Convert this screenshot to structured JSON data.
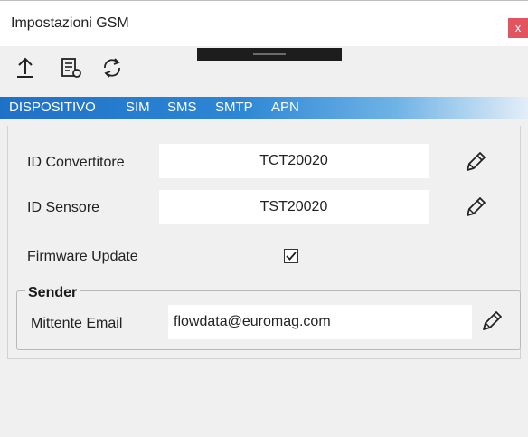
{
  "window": {
    "title": "Impostazioni GSM",
    "close_label": "x"
  },
  "toolbar": {
    "icons": [
      "upload-icon",
      "form-settings-icon",
      "refresh-icon"
    ]
  },
  "tabs": [
    {
      "label": "DISPOSITIVO"
    },
    {
      "label": "SIM"
    },
    {
      "label": "SMS"
    },
    {
      "label": "SMTP"
    },
    {
      "label": "APN"
    }
  ],
  "device": {
    "converter_id_label": "ID Convertitore",
    "converter_id_value": "TCT20020",
    "sensor_id_label": "ID Sensore",
    "sensor_id_value": "TST20020",
    "firmware_update_label": "Firmware Update",
    "firmware_update_checked": true
  },
  "sender": {
    "legend": "Sender",
    "email_label": "Mittente Email",
    "email_value": "flowdata@euromag.com"
  },
  "colors": {
    "tab_gradient_start": "#1f71c7",
    "close_button": "#e2545f"
  }
}
